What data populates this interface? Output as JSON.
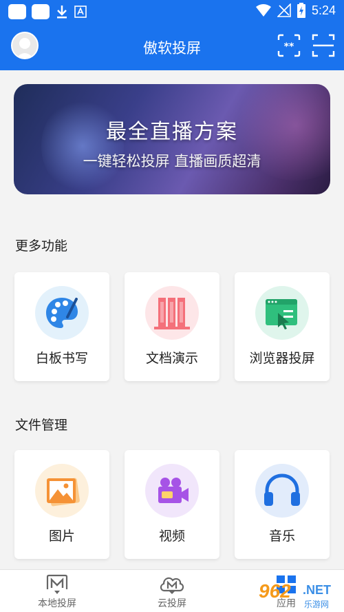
{
  "status_bar": {
    "time": "5:24"
  },
  "app_bar": {
    "title": "傲软投屏"
  },
  "banner": {
    "title": "最全直播方案",
    "subtitle": "一键轻松投屏 直播画质超清"
  },
  "sections": [
    {
      "title": "更多功能",
      "items": [
        {
          "label": "白板书写",
          "icon": "palette-icon",
          "bg": "#e3f1fb"
        },
        {
          "label": "文档演示",
          "icon": "documents-icon",
          "bg": "#fde6e8"
        },
        {
          "label": "浏览器投屏",
          "icon": "browser-icon",
          "bg": "#dff5ec"
        }
      ]
    },
    {
      "title": "文件管理",
      "items": [
        {
          "label": "图片",
          "icon": "image-icon",
          "bg": "#fdf0dc"
        },
        {
          "label": "视频",
          "icon": "video-camera-icon",
          "bg": "#f1e6fb"
        },
        {
          "label": "音乐",
          "icon": "headphones-icon",
          "bg": "#e2ecfb"
        }
      ]
    }
  ],
  "bottom_nav": [
    {
      "label": "本地投屏",
      "icon": "local-cast-icon"
    },
    {
      "label": "云投屏",
      "icon": "cloud-cast-icon"
    },
    {
      "label": "应用",
      "icon": "apps-icon"
    }
  ],
  "watermark": {
    "brand": "962",
    "domain": ".NET",
    "cn": "乐游网"
  }
}
